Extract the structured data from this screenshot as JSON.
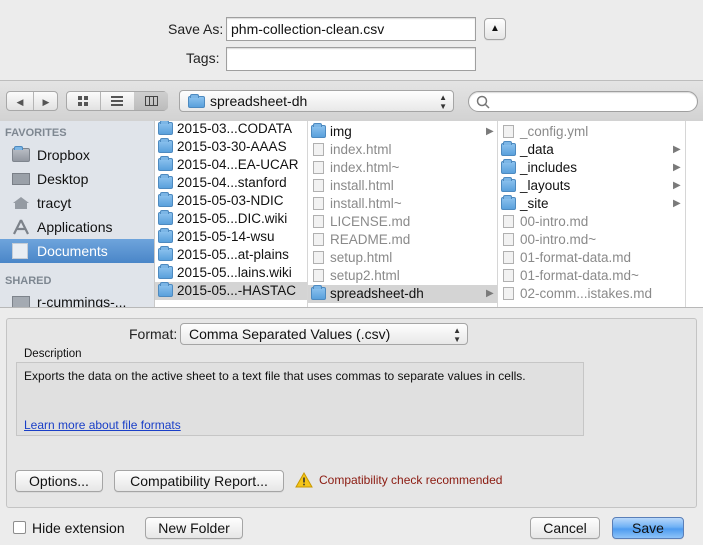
{
  "save_as": {
    "label": "Save As:",
    "value": "phm-collection-clean.csv"
  },
  "tags": {
    "label": "Tags:",
    "value": ""
  },
  "expand_button": "▲",
  "toolbar": {
    "back": "◀",
    "forward": "▶",
    "location": "spreadsheet-dh",
    "search_placeholder": ""
  },
  "sidebar": {
    "favorites_header": "FAVORITES",
    "favorites": [
      {
        "label": "Dropbox",
        "icon": "dropbox-folder-icon"
      },
      {
        "label": "Desktop",
        "icon": "desktop-icon"
      },
      {
        "label": "tracyt",
        "icon": "home-icon"
      },
      {
        "label": "Applications",
        "icon": "applications-icon"
      },
      {
        "label": "Documents",
        "icon": "documents-icon",
        "selected": true
      }
    ],
    "shared_header": "SHARED",
    "shared": [
      {
        "label": "r-cummings-...",
        "icon": "computer-icon"
      }
    ]
  },
  "column1": [
    {
      "name": "2015-03...CODATA",
      "type": "folder"
    },
    {
      "name": "2015-03-30-AAAS",
      "type": "folder"
    },
    {
      "name": "2015-04...EA-UCAR",
      "type": "folder"
    },
    {
      "name": "2015-04...stanford",
      "type": "folder"
    },
    {
      "name": "2015-05-03-NDIC",
      "type": "folder"
    },
    {
      "name": "2015-05...DIC.wiki",
      "type": "folder"
    },
    {
      "name": "2015-05-14-wsu",
      "type": "folder"
    },
    {
      "name": "2015-05...at-plains",
      "type": "folder"
    },
    {
      "name": "2015-05...lains.wiki",
      "type": "folder"
    },
    {
      "name": "2015-05...-HASTAC",
      "type": "folder",
      "selected": true
    }
  ],
  "column2": [
    {
      "name": "img",
      "type": "folder",
      "arrow": true
    },
    {
      "name": "index.html",
      "type": "doc",
      "dim": true
    },
    {
      "name": "index.html~",
      "type": "doc",
      "dim": true
    },
    {
      "name": "install.html",
      "type": "doc",
      "dim": true
    },
    {
      "name": "install.html~",
      "type": "doc",
      "dim": true
    },
    {
      "name": "LICENSE.md",
      "type": "doc",
      "dim": true
    },
    {
      "name": "README.md",
      "type": "doc",
      "dim": true
    },
    {
      "name": "setup.html",
      "type": "doc",
      "dim": true
    },
    {
      "name": "setup2.html",
      "type": "doc",
      "dim": true
    },
    {
      "name": "spreadsheet-dh",
      "type": "folder",
      "arrow": true,
      "selected": true
    }
  ],
  "column3": [
    {
      "name": "_config.yml",
      "type": "doc",
      "dim": true
    },
    {
      "name": "_data",
      "type": "folder",
      "arrow": true
    },
    {
      "name": "_includes",
      "type": "folder",
      "arrow": true
    },
    {
      "name": "_layouts",
      "type": "folder",
      "arrow": true
    },
    {
      "name": "_site",
      "type": "folder",
      "arrow": true
    },
    {
      "name": "00-intro.md",
      "type": "doc",
      "dim": true
    },
    {
      "name": "00-intro.md~",
      "type": "doc",
      "dim": true
    },
    {
      "name": "01-format-data.md",
      "type": "doc",
      "dim": true
    },
    {
      "name": "01-format-data.md~",
      "type": "doc",
      "dim": true
    },
    {
      "name": "02-comm...istakes.md",
      "type": "doc",
      "dim": true
    }
  ],
  "format": {
    "label": "Format:",
    "value": "Comma Separated Values (.csv)"
  },
  "description": {
    "header": "Description",
    "text": "Exports the data on the active sheet to a text file that uses commas to separate values in cells.",
    "link": "Learn more about file formats"
  },
  "buttons": {
    "options": "Options...",
    "compat_report": "Compatibility Report...",
    "compat_warning": "Compatibility check recommended",
    "hide_extension": "Hide extension",
    "new_folder": "New Folder",
    "cancel": "Cancel",
    "save": "Save"
  },
  "colors": {
    "warning_text": "#8b1a10",
    "link": "#1a3fc7",
    "selection": "#4a86c8"
  }
}
